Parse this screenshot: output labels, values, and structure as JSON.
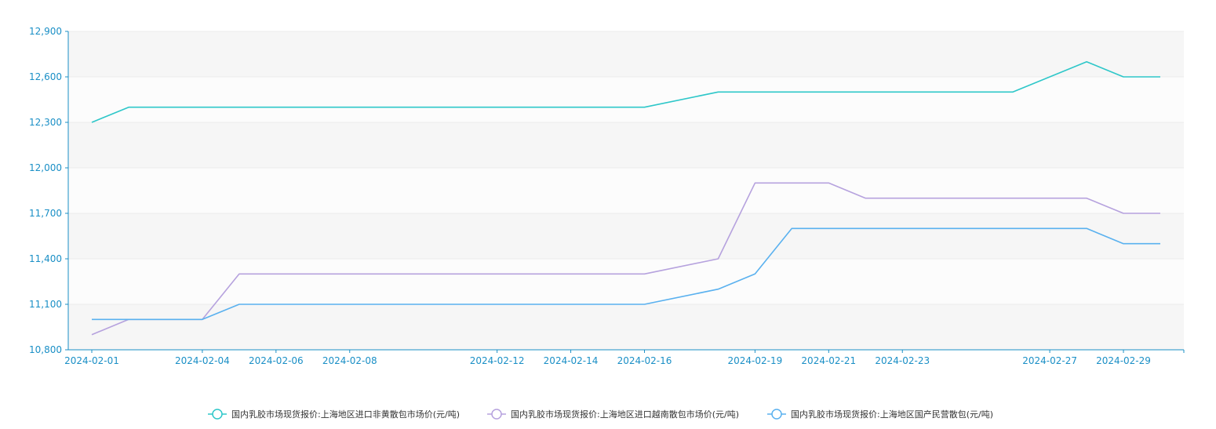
{
  "chart_data": {
    "type": "line",
    "title": "",
    "xlabel": "",
    "ylabel": "",
    "x": [
      "2024-02-01",
      "2024-02-02",
      "2024-02-04",
      "2024-02-05",
      "2024-02-06",
      "2024-02-07",
      "2024-02-08",
      "2024-02-09",
      "2024-02-12",
      "2024-02-13",
      "2024-02-14",
      "2024-02-15",
      "2024-02-16",
      "2024-02-18",
      "2024-02-19",
      "2024-02-20",
      "2024-02-21",
      "2024-02-22",
      "2024-02-23",
      "2024-02-26",
      "2024-02-27",
      "2024-02-28",
      "2024-02-29",
      "2024-03-01"
    ],
    "x_tick_labels": [
      "2024-02-01",
      "2024-02-04",
      "2024-02-06",
      "2024-02-08",
      "2024-02-12",
      "2024-02-14",
      "2024-02-16",
      "2024-02-19",
      "2024-02-21",
      "2024-02-23",
      "2024-02-27",
      "2024-02-29"
    ],
    "y_ticks": [
      10800,
      11100,
      11400,
      11700,
      12000,
      12300,
      12600,
      12900
    ],
    "y_tick_labels": [
      "10,800",
      "11,100",
      "11,400",
      "11,700",
      "12,000",
      "12,300",
      "12,600",
      "12,900"
    ],
    "ylim": [
      10800,
      12900
    ],
    "grid": "horizontal",
    "legend_position": "bottom",
    "series": [
      {
        "name": "国内乳胶市场现货报价:上海地区进口非黄散包市场价(元/吨)",
        "color": "#2ec7c9",
        "values": [
          12300,
          12400,
          12400,
          12400,
          12400,
          12400,
          12400,
          12400,
          12400,
          12400,
          12400,
          12400,
          12400,
          12500,
          12500,
          12500,
          12500,
          12500,
          12500,
          12500,
          12600,
          12700,
          12600,
          12600
        ]
      },
      {
        "name": "国内乳胶市场现货报价:上海地区进口越南散包市场价(元/吨)",
        "color": "#b6a2de",
        "values": [
          10900,
          11000,
          11000,
          11300,
          11300,
          11300,
          11300,
          11300,
          11300,
          11300,
          11300,
          11300,
          11300,
          11400,
          11900,
          11900,
          11900,
          11800,
          11800,
          11800,
          11800,
          11800,
          11700,
          11700
        ]
      },
      {
        "name": "国内乳胶市场现货报价:上海地区国产民营散包(元/吨)",
        "color": "#5ab1ef",
        "values": [
          11000,
          11000,
          11000,
          11100,
          11100,
          11100,
          11100,
          11100,
          11100,
          11100,
          11100,
          11100,
          11100,
          11200,
          11300,
          11600,
          11600,
          11600,
          11600,
          11600,
          11600,
          11600,
          11500,
          11500
        ]
      }
    ]
  }
}
